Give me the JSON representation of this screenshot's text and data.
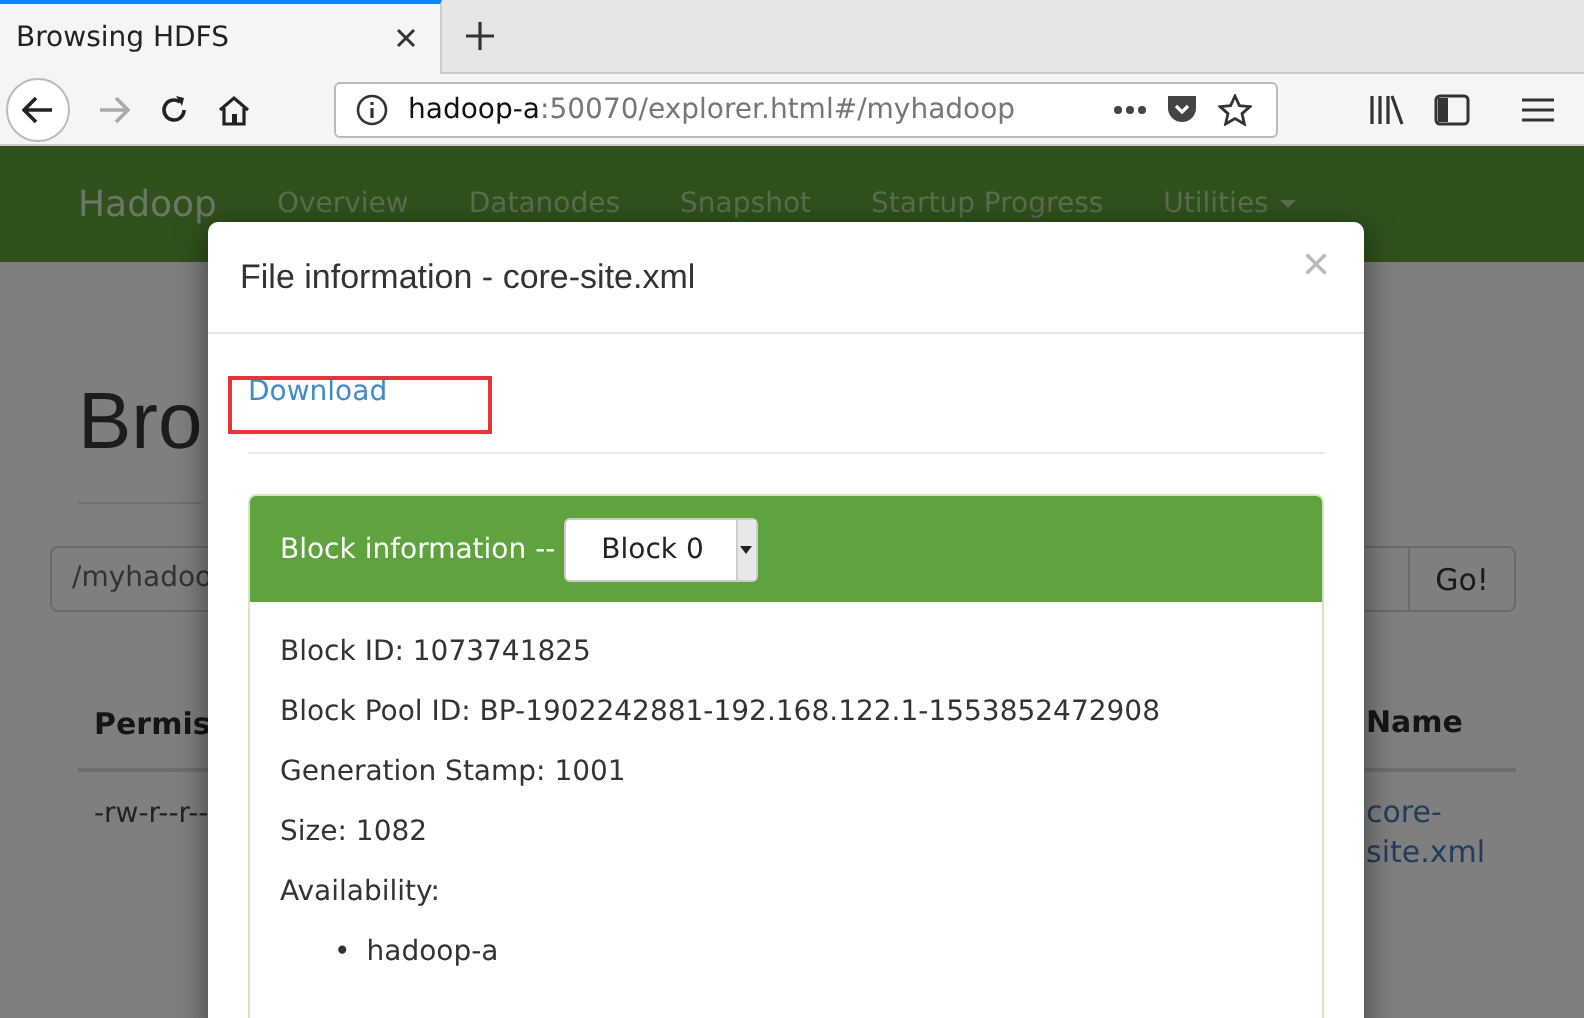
{
  "browser": {
    "tab": {
      "title": "Browsing HDFS",
      "selected": true
    },
    "url": {
      "host": "hadoop-a",
      "rest": ":50070/explorer.html#/myhadoop"
    },
    "forward_disabled": true
  },
  "navbar": {
    "brand": "Hadoop",
    "items": [
      {
        "label": "Overview"
      },
      {
        "label": "Datanodes"
      },
      {
        "label": "Snapshot"
      },
      {
        "label": "Startup Progress"
      },
      {
        "label": "Utilities",
        "dropdown": true
      }
    ]
  },
  "page": {
    "heading": "Bro",
    "path": "/myhadoo",
    "go": "Go!",
    "columns": [
      "Permis",
      "Name"
    ],
    "rows": [
      [
        "-rw-r--r--",
        "core-site.xml"
      ]
    ]
  },
  "modal": {
    "title": "File information - core-site.xml",
    "close": "×",
    "download": {
      "label": "Download",
      "highlighted": true
    },
    "panel": {
      "title": "Block information --",
      "select": "Block 0",
      "fields": [
        "Block ID: 1073741825",
        "Block Pool ID: BP-1902242881-192.168.122.1-1553852472908",
        "Generation Stamp: 1001",
        "Size: 1082",
        "Availability:"
      ],
      "hosts": [
        {
          "bullet": "•",
          "text": "hadoop-a"
        }
      ]
    }
  }
}
